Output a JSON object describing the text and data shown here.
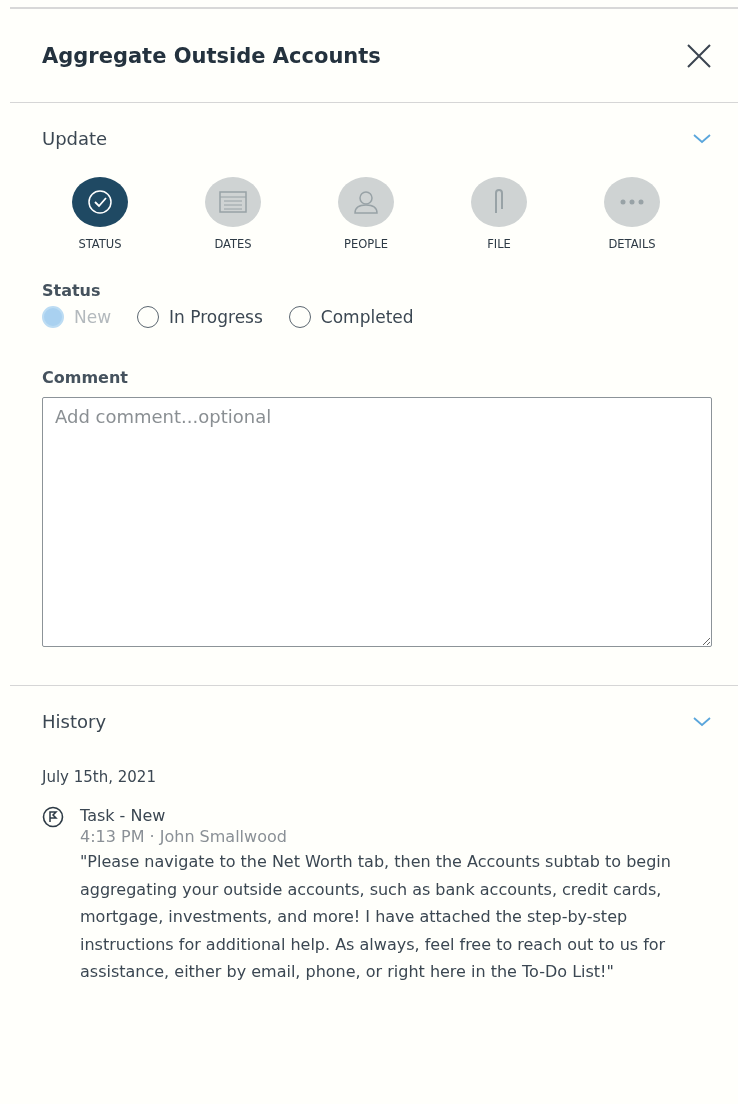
{
  "panel": {
    "title": "Aggregate Outside Accounts"
  },
  "update": {
    "title": "Update",
    "expanded": true,
    "tabs": [
      {
        "kind": "status",
        "label": "STATUS",
        "selected": true
      },
      {
        "kind": "dates",
        "label": "DATES",
        "selected": false
      },
      {
        "kind": "people",
        "label": "PEOPLE",
        "selected": false
      },
      {
        "kind": "file",
        "label": "FILE",
        "selected": false
      },
      {
        "kind": "details",
        "label": "DETAILS",
        "selected": false
      }
    ],
    "status": {
      "label": "Status",
      "options": [
        {
          "label": "New",
          "selected": true,
          "disabled": true
        },
        {
          "label": "In Progress",
          "selected": false,
          "disabled": false
        },
        {
          "label": "Completed",
          "selected": false,
          "disabled": false
        }
      ]
    },
    "comment": {
      "label": "Comment",
      "placeholder": "Add comment...optional"
    }
  },
  "history": {
    "title": "History",
    "expanded": true,
    "groups": [
      {
        "date": "July 15th, 2021",
        "entries": [
          {
            "title": "Task - New",
            "meta": "4:13 PM · John Smallwood",
            "text": "\"Please navigate to the Net Worth tab, then the Accounts subtab to begin aggregating your outside accounts, such as bank accounts, credit cards, mortgage, investments, and more! I have attached the step-by-step instructions for additional help. As always, feel free to reach out to us for assistance, either by email, phone, or right here in the To-Do List!\""
          }
        ]
      }
    ]
  }
}
